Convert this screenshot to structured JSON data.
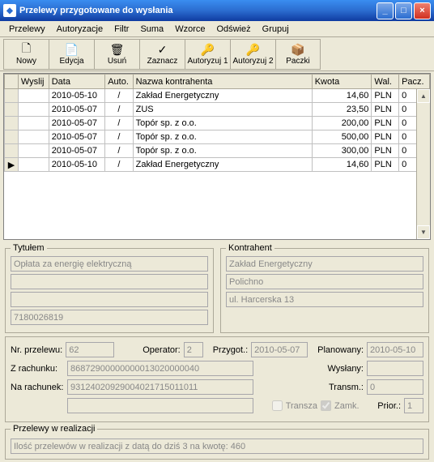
{
  "window": {
    "title": "Przelewy przygotowane do wysłania"
  },
  "menu": {
    "items": [
      "Przelewy",
      "Autoryzacje",
      "Filtr",
      "Suma",
      "Wzorce",
      "Odśwież",
      "Grupuj"
    ]
  },
  "toolbar": {
    "nowy": "Nowy",
    "edycja": "Edycja",
    "usun": "Usuń",
    "zaznacz": "Zaznacz",
    "autoryzuj1": "Autoryzuj 1",
    "autoryzuj2": "Autoryzuj 2",
    "paczki": "Paczki"
  },
  "grid": {
    "headers": {
      "wyslij": "Wyslij",
      "data": "Data",
      "auto": "Auto.",
      "nazwa": "Nazwa kontrahenta",
      "kwota": "Kwota",
      "wal": "Wal.",
      "pacz": "Pacz."
    },
    "rows": [
      {
        "data": "2010-05-10",
        "auto": "/",
        "nazwa": "Zakład Energetyczny",
        "kwota": "14,60",
        "wal": "PLN",
        "pacz": "0"
      },
      {
        "data": "2010-05-07",
        "auto": "/",
        "nazwa": "ZUS",
        "kwota": "23,50",
        "wal": "PLN",
        "pacz": "0"
      },
      {
        "data": "2010-05-07",
        "auto": "/",
        "nazwa": "Topór sp. z o.o.",
        "kwota": "200,00",
        "wal": "PLN",
        "pacz": "0"
      },
      {
        "data": "2010-05-07",
        "auto": "/",
        "nazwa": "Topór sp. z o.o.",
        "kwota": "500,00",
        "wal": "PLN",
        "pacz": "0"
      },
      {
        "data": "2010-05-07",
        "auto": "/",
        "nazwa": "Topór sp. z o.o.",
        "kwota": "300,00",
        "wal": "PLN",
        "pacz": "0"
      },
      {
        "data": "2010-05-10",
        "auto": "/",
        "nazwa": "Zakład Energetyczny",
        "kwota": "14,60",
        "wal": "PLN",
        "pacz": "0"
      }
    ]
  },
  "tytulem": {
    "legend": "Tytułem",
    "line1": "Opłata za energię elektryczną",
    "line2": "",
    "line3": "",
    "line4": "7180026819"
  },
  "kontrahent": {
    "legend": "Kontrahent",
    "line1": "Zakład Energetyczny",
    "line2": "Polichno",
    "line3": "ul. Harcerska 13"
  },
  "details": {
    "nr_przelewu_label": "Nr. przelewu:",
    "nr_przelewu": "62",
    "operator_label": "Operator:",
    "operator": "2",
    "przygot_label": "Przygot.:",
    "przygot": "2010-05-07",
    "planowany_label": "Planowany:",
    "planowany": "2010-05-10",
    "z_rachunku_label": "Z rachunku:",
    "z_rachunku": "86872900000000013020000040",
    "wyslany_label": "Wysłany:",
    "wyslany": "",
    "na_rachunek_label": "Na rachunek:",
    "na_rachunek": "93124020929004021715011011",
    "transm_label": "Transm.:",
    "transm": "0",
    "transza_label": "Transza",
    "zamk_label": "Zamk.",
    "prior_label": "Prior.:",
    "prior": "1"
  },
  "realizacja": {
    "legend": "Przelewy w realizacji",
    "text": "Ilość przelewów w realizacji z datą do dziś 3 na kwotę: 460"
  }
}
